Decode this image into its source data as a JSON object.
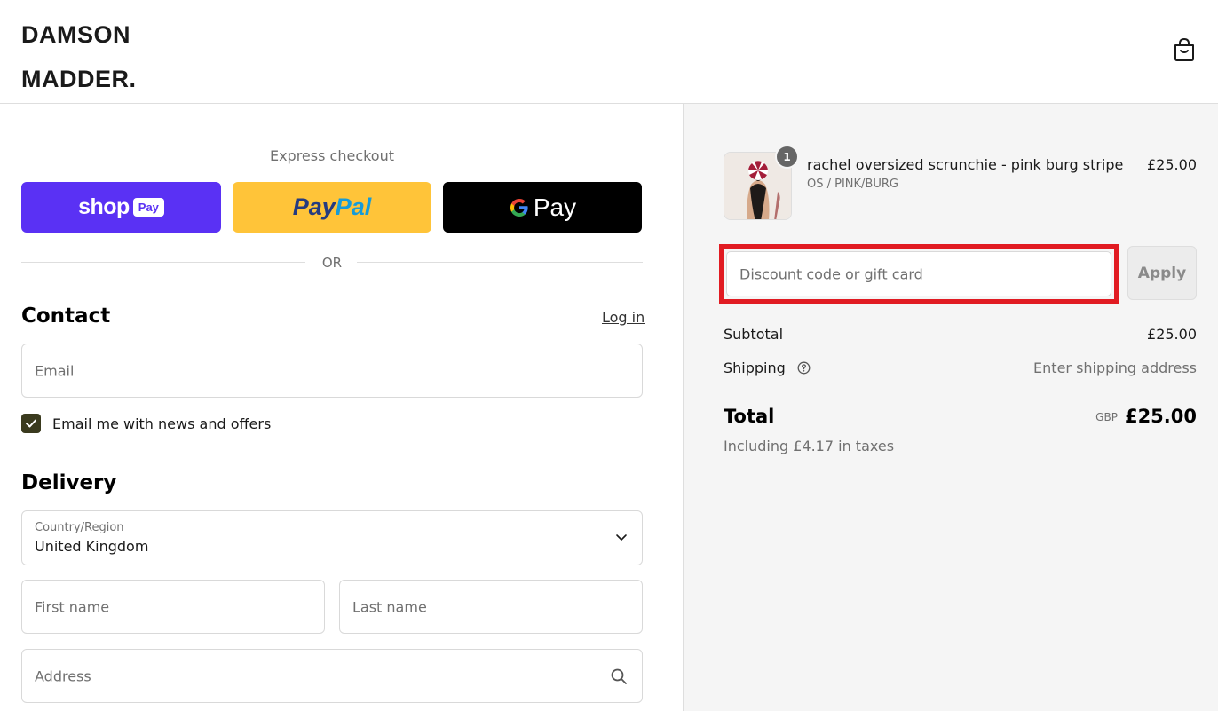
{
  "header": {
    "logo_line1": "DAMSON",
    "logo_line2": "MADDER."
  },
  "express": {
    "title": "Express checkout",
    "shop_label": "shop",
    "shop_badge": "Pay",
    "paypal_a": "Pay",
    "paypal_b": "Pal",
    "gpay_label": "Pay",
    "or_label": "OR"
  },
  "contact": {
    "title": "Contact",
    "login_label": "Log in",
    "email_placeholder": "Email",
    "newsletter_label": "Email me with news and offers",
    "newsletter_checked": true
  },
  "delivery": {
    "title": "Delivery",
    "country_label": "Country/Region",
    "country_value": "United Kingdom",
    "first_name_placeholder": "First name",
    "last_name_placeholder": "Last name",
    "address_placeholder": "Address"
  },
  "summary": {
    "product": {
      "quantity": "1",
      "name": "rachel oversized scrunchie - pink burg stripe",
      "variant": "OS / PINK/BURG",
      "price": "£25.00"
    },
    "discount_placeholder": "Discount code or gift card",
    "apply_label": "Apply",
    "subtotal_label": "Subtotal",
    "subtotal_value": "£25.00",
    "shipping_label": "Shipping",
    "shipping_value": "Enter shipping address",
    "total_label": "Total",
    "currency": "GBP",
    "total_value": "£25.00",
    "taxes_note": "Including £4.17 in taxes"
  },
  "colors": {
    "shop_pay": "#5a31f4",
    "paypal": "#ffc439",
    "gpay": "#000000",
    "highlight": "#e11b22"
  }
}
